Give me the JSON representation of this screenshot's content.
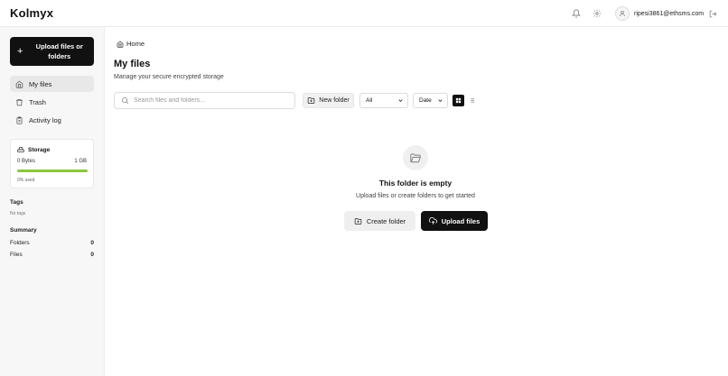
{
  "app": {
    "logo": "Kolmyx"
  },
  "header": {
    "user_email": "ripesi3861@ethsms.com"
  },
  "sidebar": {
    "upload_label": "Upload files or folders",
    "nav": [
      {
        "label": "My files",
        "icon": "home-icon",
        "active": true
      },
      {
        "label": "Trash",
        "icon": "trash-icon",
        "active": false
      },
      {
        "label": "Activity log",
        "icon": "clipboard-icon",
        "active": false
      }
    ],
    "storage": {
      "title": "Storage",
      "used": "0 Bytes",
      "total": "1 GB",
      "percent_text": "0% used",
      "fill_fraction": 1.0,
      "bar_color": "#8cc63f"
    },
    "tags": {
      "title": "Tags",
      "empty": "No tags"
    },
    "summary": {
      "title": "Summary",
      "rows": [
        {
          "label": "Folders",
          "value": "0"
        },
        {
          "label": "Files",
          "value": "0"
        }
      ]
    }
  },
  "main": {
    "breadcrumb": "Home",
    "title": "My files",
    "subtitle": "Manage your secure encrypted storage",
    "search_placeholder": "Search files and folders...",
    "new_folder_label": "New folder",
    "filter_value": "All",
    "sort_value": "Date",
    "empty": {
      "title": "This folder is empty",
      "subtitle": "Upload files or create folders to get started",
      "create_label": "Create folder",
      "upload_label": "Upload files"
    }
  }
}
